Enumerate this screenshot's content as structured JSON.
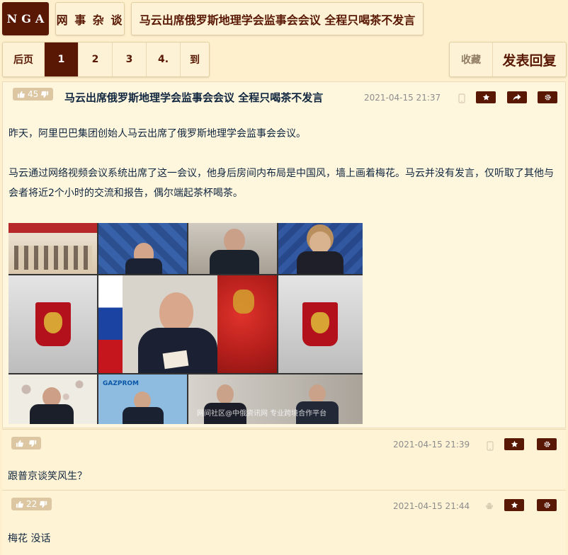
{
  "header": {
    "logo": "NGA",
    "forum": "网 事 杂 谈",
    "thread_title": "马云出席俄罗斯地理学会监事会会议 全程只喝茶不发言"
  },
  "pager": {
    "prev": "后页",
    "pages": [
      "1",
      "2",
      "3",
      "4."
    ],
    "active": "1",
    "goto": "到"
  },
  "actions": {
    "favorite": "收藏",
    "reply": "发表回复"
  },
  "posts": [
    {
      "votes": "45",
      "title": "马云出席俄罗斯地理学会监事会会议 全程只喝茶不发言",
      "time": "2021-04-15 21:37",
      "paragraphs": [
        "昨天，阿里巴巴集团创始人马云出席了俄罗斯地理学会监事会会议。",
        "马云通过网络视频会议系统出席了这一会议，他身后房间内布局是中国风，墙上画着梅花。马云并没有发言，仅听取了其他与会者将近2个小时的交流和报告，偶尔端起茶杯喝茶。"
      ],
      "image_watermark": "网间社区@中俄资讯网 专业跨境合作平台",
      "image_logo_text": "GAZPROM"
    },
    {
      "votes": "",
      "time": "2021-04-15 21:39",
      "content": "跟普京谈笑风生？"
    },
    {
      "votes": "22",
      "time": "2021-04-15 21:44",
      "content": "梅花 没话"
    }
  ],
  "colors": {
    "brand": "#591804",
    "background": "#fff0cd",
    "vote_bg": "#dcc7a2"
  }
}
